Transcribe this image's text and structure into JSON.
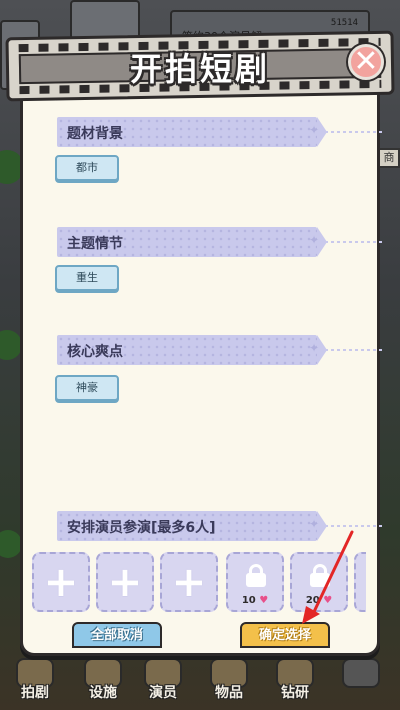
{
  "modal": {
    "title": "开拍短剧",
    "close_symbol": "✕"
  },
  "background": {
    "topbar_text": "签约30个演员解",
    "score": "51514",
    "right_tab": "商"
  },
  "sections": [
    {
      "title": "题材背景",
      "selected_tag": "都市"
    },
    {
      "title": "主题情节",
      "selected_tag": "重生"
    },
    {
      "title": "核心爽点",
      "selected_tag": "神豪"
    }
  ],
  "actors": {
    "title": "安排演员参演[最多6人]",
    "slots": [
      {
        "state": "empty",
        "symbol": "+"
      },
      {
        "state": "empty",
        "symbol": "+"
      },
      {
        "state": "empty",
        "symbol": "+"
      },
      {
        "state": "locked",
        "cost": "10",
        "icon": "heart-icon"
      },
      {
        "state": "locked",
        "cost": "20",
        "icon": "heart-icon"
      }
    ]
  },
  "buttons": {
    "cancel_all": "全部取消",
    "confirm": "确定选择"
  },
  "bottom_nav": [
    {
      "label": "拍剧",
      "icon": "camera-icon"
    },
    {
      "label": "设施",
      "icon": "facility-icon"
    },
    {
      "label": "演员",
      "icon": "actor-icon"
    },
    {
      "label": "物品",
      "icon": "bag-icon"
    },
    {
      "label": "钻研",
      "icon": "research-icon"
    },
    {
      "label": "",
      "icon": "lock-icon"
    }
  ],
  "colors": {
    "modal_bg": "#fbf8ec",
    "header_bar": "#c9c9ec",
    "tag_bg": "#cfe7f3",
    "slot_bg": "#d8d6f0",
    "close_btn": "#f2a39e",
    "confirm_btn": "#f3c04a",
    "cancel_btn": "#8fc8e8",
    "arrow": "#e32626"
  }
}
